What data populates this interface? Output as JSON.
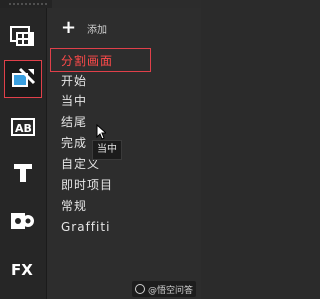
{
  "toolbar": {
    "tools": [
      {
        "icon": "media-library-icon"
      },
      {
        "icon": "transitions-icon",
        "active": true
      },
      {
        "icon": "ab-titles-icon",
        "label": "AB"
      },
      {
        "icon": "text-icon",
        "label": "T"
      },
      {
        "icon": "effects-icon"
      },
      {
        "icon": "fx-icon",
        "label": "FX"
      }
    ]
  },
  "panel": {
    "add_label": "添加",
    "menu": [
      {
        "label": "分割画面",
        "selected": true
      },
      {
        "label": "开始"
      },
      {
        "label": "当中"
      },
      {
        "label": "结尾"
      },
      {
        "label": "完成"
      },
      {
        "label": "自定义"
      },
      {
        "label": "即时项目"
      },
      {
        "label": "常规"
      },
      {
        "label": "Graffiti"
      }
    ],
    "tooltip": "当中"
  },
  "watermark": {
    "text": "@悟空问答"
  },
  "colors": {
    "highlight": "#e0404a",
    "selected_text": "#ff4a4a",
    "background": "#2c2c2c"
  }
}
